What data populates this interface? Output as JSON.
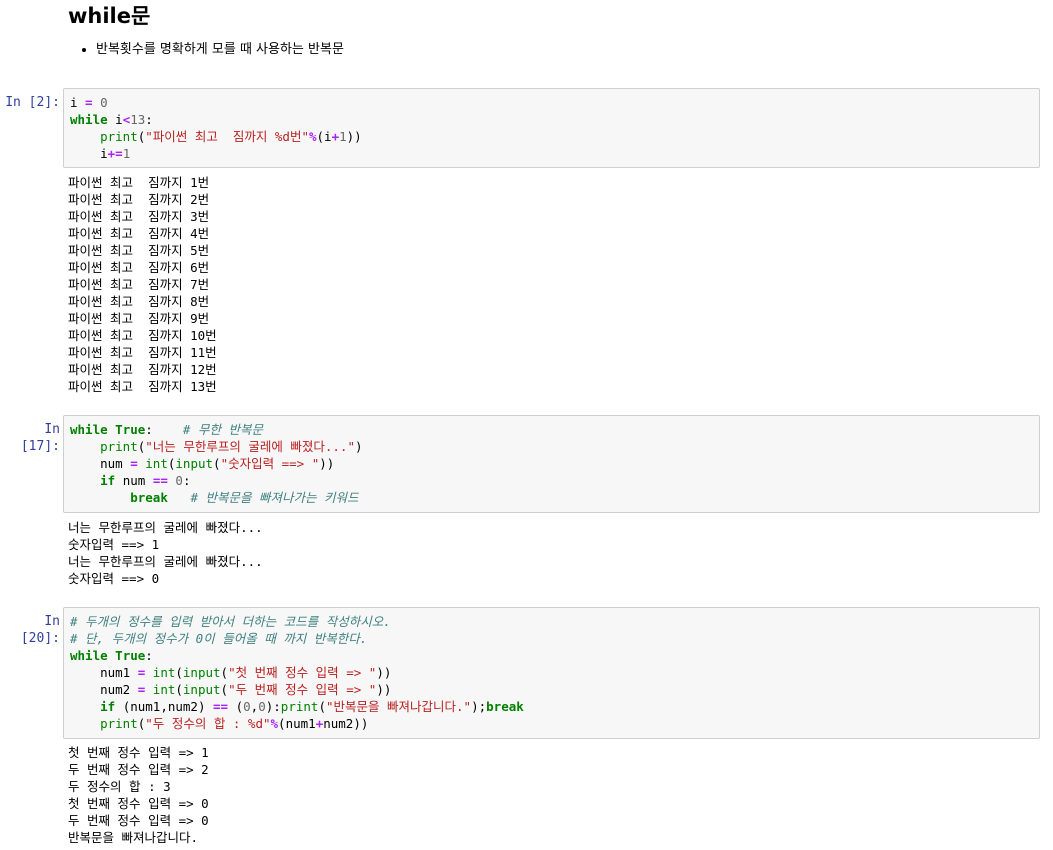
{
  "markdown": {
    "heading": "while문",
    "bullet": "반복횟수를 명확하게 모를 때 사용하는 반복문"
  },
  "cells": [
    {
      "prompt": "In [2]:",
      "output": "파이썬 최고  짐까지 1번\n파이썬 최고  짐까지 2번\n파이썬 최고  짐까지 3번\n파이썬 최고  짐까지 4번\n파이썬 최고  짐까지 5번\n파이썬 최고  짐까지 6번\n파이썬 최고  짐까지 7번\n파이썬 최고  짐까지 8번\n파이썬 최고  짐까지 9번\n파이썬 최고  짐까지 10번\n파이썬 최고  짐까지 11번\n파이썬 최고  짐까지 12번\n파이썬 최고  짐까지 13번"
    },
    {
      "prompt": "In [17]:",
      "output": "너는 무한루프의 굴레에 빠졌다...\n숫자입력 ==> 1\n너는 무한루프의 굴레에 빠졌다...\n숫자입력 ==> 0"
    },
    {
      "prompt": "In [20]:",
      "output": "첫 번째 정수 입력 => 1\n두 번째 정수 입력 => 2\n두 정수의 합 : 3\n첫 번째 정수 입력 => 0\n두 번째 정수 입력 => 0\n반복문을 빠져나갑니다."
    }
  ],
  "code": {
    "c1": {
      "l1_var": "i",
      "l1_op": " = ",
      "l1_num": "0",
      "l2_kw": "while",
      "l2_rest": " i",
      "l2_op": "<",
      "l2_num": "13",
      "l2_colon": ":",
      "l3_indent": "    ",
      "l3_fn": "print",
      "l3_paren": "(",
      "l3_str": "\"파이썬 최고  짐까지 %d번\"",
      "l3_pct": "%",
      "l3_args": "(i",
      "l3_plus": "+",
      "l3_one": "1",
      "l3_close": "))",
      "l4_indent": "    i",
      "l4_op": "+=",
      "l4_num": "1"
    },
    "c2": {
      "l1_kw": "while",
      "l1_sp": " ",
      "l1_true": "True",
      "l1_colon": ":    ",
      "l1_cm": "# 무한 반복문",
      "l2_indent": "    ",
      "l2_fn": "print",
      "l2_open": "(",
      "l2_str": "\"너는 무한루프의 굴레에 빠졌다...\"",
      "l2_close": ")",
      "l3_pre": "    num ",
      "l3_op": "=",
      "l3_sp": " ",
      "l3_int": "int",
      "l3_open": "(",
      "l3_input": "input",
      "l3_open2": "(",
      "l3_str": "\"숫자입력 ==> \"",
      "l3_close": "))",
      "l4_indent": "    ",
      "l4_kw": "if",
      "l4_var": " num ",
      "l4_op": "==",
      "l4_sp": " ",
      "l4_num": "0",
      "l4_colon": ":",
      "l5_indent": "        ",
      "l5_kw": "break",
      "l5_sp": "   ",
      "l5_cm": "# 반복문을 빠져나가는 키워드"
    },
    "c3": {
      "l1_cm": "# 두개의 정수를 입력 받아서 더하는 코드를 작성하시오.",
      "l2_cm": "# 단, 두개의 정수가 0이 들어올 때 까지 반복한다.",
      "l3_kw": "while",
      "l3_sp": " ",
      "l3_true": "True",
      "l3_colon": ":",
      "l4_pre": "    num1 ",
      "l4_op": "=",
      "l4_sp": " ",
      "l4_int": "int",
      "l4_open": "(",
      "l4_input": "input",
      "l4_open2": "(",
      "l4_str": "\"첫 번째 정수 입력 => \"",
      "l4_close": "))",
      "l5_pre": "    num2 ",
      "l5_op": "=",
      "l5_sp": " ",
      "l5_int": "int",
      "l5_open": "(",
      "l5_input": "input",
      "l5_open2": "(",
      "l5_str": "\"두 번째 정수 입력 => \"",
      "l5_close": "))",
      "l6_indent": "    ",
      "l6_kw": "if",
      "l6_mid": " (num1,num2) ",
      "l6_op": "==",
      "l6_sp": " ",
      "l6_tuple_open": "(",
      "l6_n1": "0",
      "l6_comma": ",",
      "l6_n2": "0",
      "l6_tuple_close": "):",
      "l6_fn": "print",
      "l6_open": "(",
      "l6_str": "\"반복문을 빠져나갑니다.\"",
      "l6_close": ");",
      "l6_break": "break",
      "l7_indent": "    ",
      "l7_fn": "print",
      "l7_open": "(",
      "l7_str": "\"두 정수의 합 : %d\"",
      "l7_pct": "%",
      "l7_args": "(num1",
      "l7_plus": "+",
      "l7_rest": "num2))"
    }
  },
  "colors": {
    "keyword": "#008000",
    "string": "#BA2121",
    "comment": "#408080",
    "number": "#666666",
    "operator": "#AA22FF",
    "prompt": "#303F9F",
    "input_bg": "#f7f7f7",
    "input_border": "#cfcfcf"
  }
}
